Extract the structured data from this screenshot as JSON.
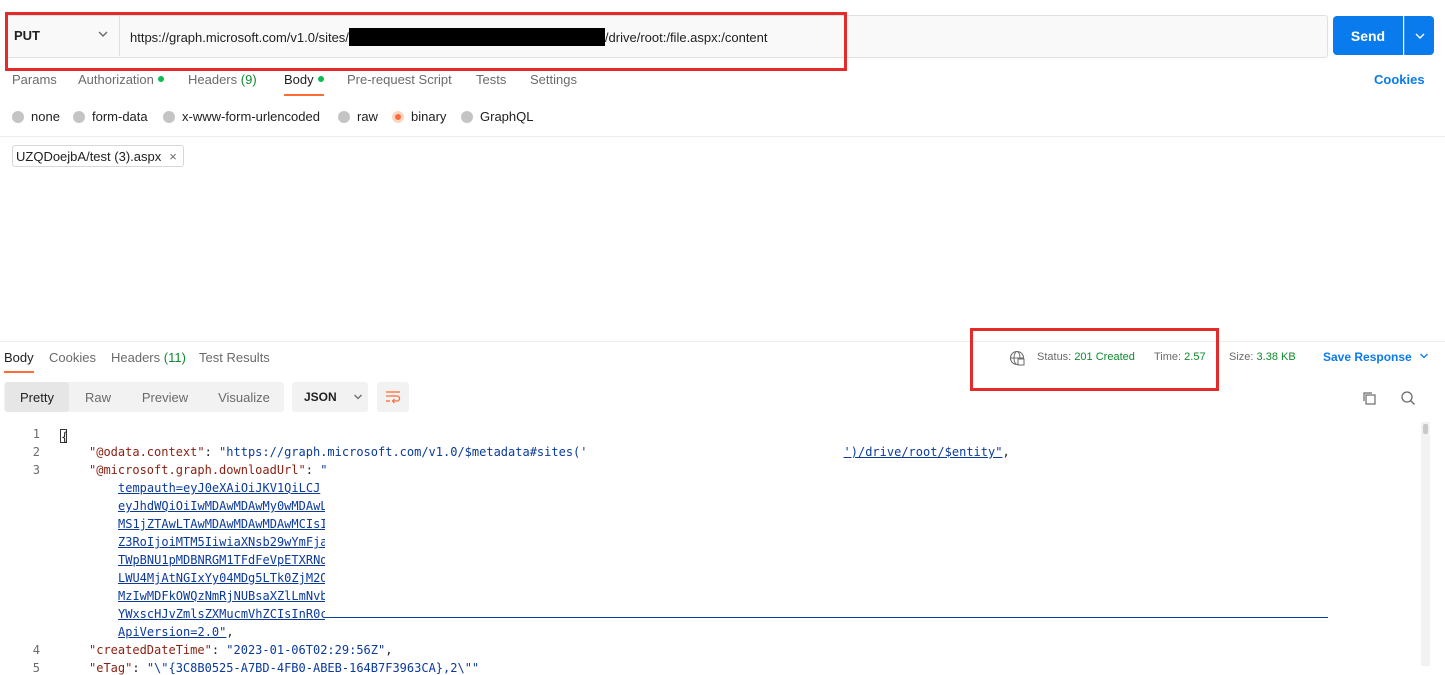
{
  "request": {
    "method": "PUT",
    "url_prefix": "https://graph.microsoft.com/v1.0/sites/",
    "url_suffix": "/drive/root:/file.aspx:/content",
    "send_label": "Send"
  },
  "request_tabs": {
    "params": "Params",
    "authorization": "Authorization",
    "headers": "Headers",
    "headers_count": "(9)",
    "body": "Body",
    "prerequest": "Pre-request Script",
    "tests": "Tests",
    "settings": "Settings",
    "cookies": "Cookies"
  },
  "body_types": {
    "none": "none",
    "form_data": "form-data",
    "urlencoded": "x-www-form-urlencoded",
    "raw": "raw",
    "binary": "binary",
    "graphql": "GraphQL",
    "selected": "binary"
  },
  "file": {
    "name": "UZQDoejbA/test (3).aspx",
    "remove": "×"
  },
  "response_tabs": {
    "body": "Body",
    "cookies": "Cookies",
    "headers": "Headers",
    "headers_count": "(11)",
    "test_results": "Test Results"
  },
  "response_meta": {
    "status_label": "Status:",
    "status_value": "201 Created",
    "time_label": "Time:",
    "time_value": "2.57",
    "size_label": "Size:",
    "size_value": "3.38 KB",
    "save_response": "Save Response"
  },
  "view_modes": {
    "pretty": "Pretty",
    "raw": "Raw",
    "preview": "Preview",
    "visualize": "Visualize",
    "format": "JSON"
  },
  "code": {
    "line_numbers": [
      "1",
      "2",
      "3",
      "4",
      "5"
    ],
    "brace": "{",
    "context_key": "\"@odata.context\"",
    "context_val_start": "\"https://graph.microsoft.com/v1.0/$metadata#sites('",
    "context_val_end": "')/drive/root/$entity\"",
    "download_key": "\"@microsoft.graph.downloadUrl\"",
    "download_start": "\"",
    "url_lines": [
      "tempauth=eyJ0eXAiOiJKV1QiLCJ",
      "eyJhdWQiOiIwMDAwMDAwMy0wMDAwL",
      "MS1jZTAwLTAwMDAwMDAwMDAwMCIsI",
      "Z3RoIjoiMTM5IiwiaXNsb29wYmFja",
      "TWpBNU1pMDBNRGM1TFdFeVpETXRNd",
      "LWU4MjAtNGIxYy04MDg5LTk0ZjM2O",
      "MzIwMDFkOWQzNmRjNUBsaXZlLmNvb",
      "YWxscHJvZmlsZXMucmVhZCIsInR0c"
    ],
    "api_version": "ApiVersion=2.0\"",
    "created_key": "\"createdDateTime\"",
    "created_val": "\"2023-01-06T02:29:56Z\"",
    "etag_key": "\"eTag\"",
    "etag_val": "\"\\\"{3C8B0525-A7BD-4FB0-ABEB-164B7F3963CA},2\\\"\""
  },
  "colors": {
    "accent": "#ff6c37",
    "primary": "#097bed",
    "success": "#0f8a2f",
    "highlight_box": "#e32b2b"
  }
}
